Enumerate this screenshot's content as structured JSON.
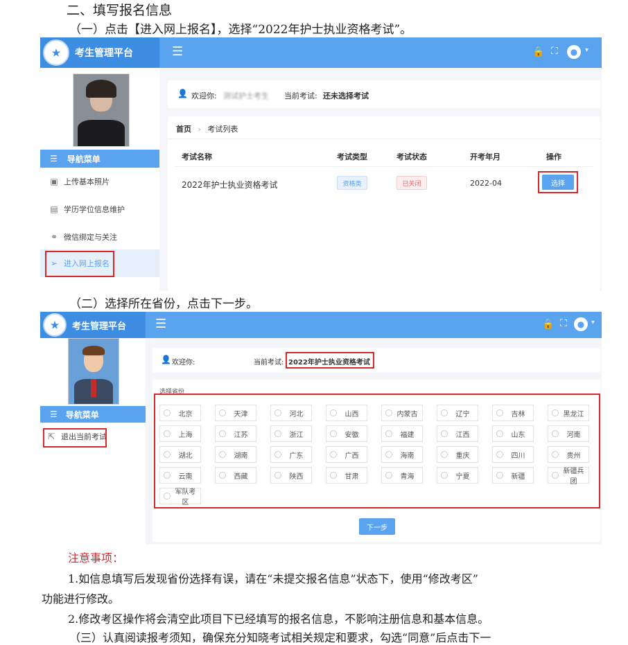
{
  "doc": {
    "section_title": "二、填写报名信息",
    "step1": "（一）点击【进入网上报名】，选择“2022年护士执业资格考试”。",
    "step2": "（二）选择所在省份，点击下一步。",
    "notes_title": "注意事项：",
    "note1_line1": "1.如信息填写后发现省份选择有误，请在“未提交报名信息”状态下，使用“修改考区”",
    "note1_line2": "功能进行修改。",
    "note2": "2.修改考区操作将会清空此项目下已经填写的报名信息，不影响注册信息和基本信息。",
    "step3": "（三）认真阅读报考须知，确保充分知晓考试相关规定和要求，勾选“同意”后点击下一"
  },
  "app": {
    "brand": "考生管理平台",
    "nav_header": "导航菜单"
  },
  "shot1": {
    "welcome_label": "欢迎你:",
    "welcome_name": "测试护士考生",
    "current_exam_label": "当前考试:",
    "current_exam_value": "还未选择考试",
    "breadcrumb_home": "首页",
    "breadcrumb_current": "考试列表",
    "nav_items": [
      "上传基本照片",
      "学历学位信息维护",
      "微信绑定与关注",
      "进入网上报名"
    ],
    "table_headers": [
      "考试名称",
      "考试类型",
      "考试状态",
      "开考年月",
      "操作"
    ],
    "row": {
      "name": "2022年护士执业资格考试",
      "type": "资格类",
      "status": "已关闭",
      "date": "2022-04",
      "action": "选择"
    }
  },
  "shot2": {
    "welcome_label": "欢迎你:",
    "welcome_name": "",
    "current_exam_label": "当前考试:",
    "current_exam_value": "2022年护士执业资格考试",
    "nav_items": [
      "退出当前考试"
    ],
    "province_label": "选择省份",
    "provinces": [
      "北京",
      "天津",
      "河北",
      "山西",
      "内蒙古",
      "辽宁",
      "吉林",
      "黑龙江",
      "上海",
      "江苏",
      "浙江",
      "安徽",
      "福建",
      "江西",
      "山东",
      "河南",
      "湖北",
      "湖南",
      "广东",
      "广西",
      "海南",
      "重庆",
      "四川",
      "贵州",
      "云南",
      "西藏",
      "陕西",
      "甘肃",
      "青海",
      "宁夏",
      "新疆",
      "新疆兵团",
      "军队考区"
    ],
    "next_button": "下一步"
  }
}
